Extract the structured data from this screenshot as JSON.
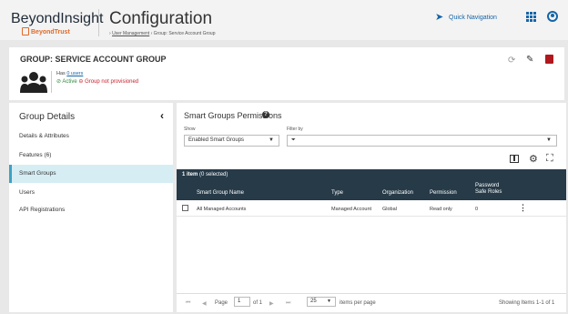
{
  "header": {
    "brand_name": "BeyondInsight",
    "brand_sub": "BeyondTrust",
    "title": "Configuration",
    "breadcrumb": {
      "root": "User Management",
      "separator": "›",
      "current": "Group: Service Account Group"
    },
    "quick_nav_label": "Quick Navigation",
    "icons": [
      "paper-plane-icon",
      "grid-icon",
      "user-icon"
    ]
  },
  "group": {
    "title": "GROUP: SERVICE ACCOUNT GROUP",
    "has_prefix": "Has",
    "users_link": "0 users",
    "status_active": "Active",
    "status_provisioned": "Group not provisioned",
    "active_color": "#2e8b3e",
    "error_color": "#c8202a"
  },
  "sidebar": {
    "title": "Group Details",
    "items": [
      {
        "label": "Details & Attributes",
        "active": false
      },
      {
        "label": "Features (6)",
        "active": false
      },
      {
        "label": "Smart Groups",
        "active": true
      },
      {
        "label": "Users",
        "active": false
      },
      {
        "label": "API Registrations",
        "active": false
      }
    ]
  },
  "main": {
    "title": "Smart Groups Permissions",
    "show_label": "Show",
    "show_value": "Enabled Smart Groups",
    "filter_label": "Filter by",
    "item_count": "1 item",
    "selected": "(0 selected)",
    "columns": {
      "name": "Smart Group Name",
      "type": "Type",
      "org": "Organization",
      "permission": "Permission",
      "pwd_line1": "Password",
      "pwd_line2": "Safe Roles"
    },
    "rows": [
      {
        "name": "All Managed Accounts",
        "type": "Managed Account",
        "org": "Global",
        "permission": "Read only",
        "roles": "0"
      }
    ]
  },
  "pager": {
    "page_label": "Page",
    "page_value": "1",
    "of_label": "of 1",
    "page_size": "25",
    "per_page_label": "items per page",
    "showing": "Showing Items 1-1 of 1"
  },
  "colors": {
    "accent": "#1565a8",
    "table_header": "#263a48",
    "active_nav": "#d6edf4",
    "danger": "#b0181d"
  }
}
